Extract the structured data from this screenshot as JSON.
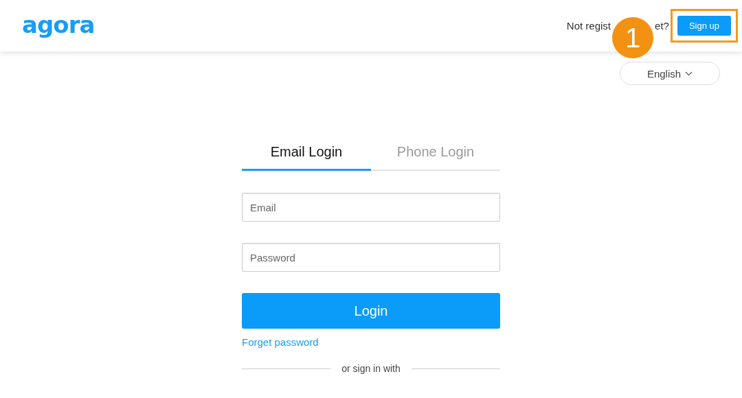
{
  "header": {
    "logo": "agora",
    "prompt_before": "Not regist",
    "prompt_after": "et?",
    "signup_button": "Sign up",
    "step_badge": "1"
  },
  "language": {
    "label": "English"
  },
  "tabs": [
    {
      "label": "Email Login",
      "selected": true
    },
    {
      "label": "Phone Login",
      "selected": false
    }
  ],
  "form": {
    "email": {
      "placeholder": "Email"
    },
    "password": {
      "placeholder": "Password"
    },
    "login_button": "Login",
    "forget_link": "Forget password",
    "divider_text": "or sign in with"
  }
}
